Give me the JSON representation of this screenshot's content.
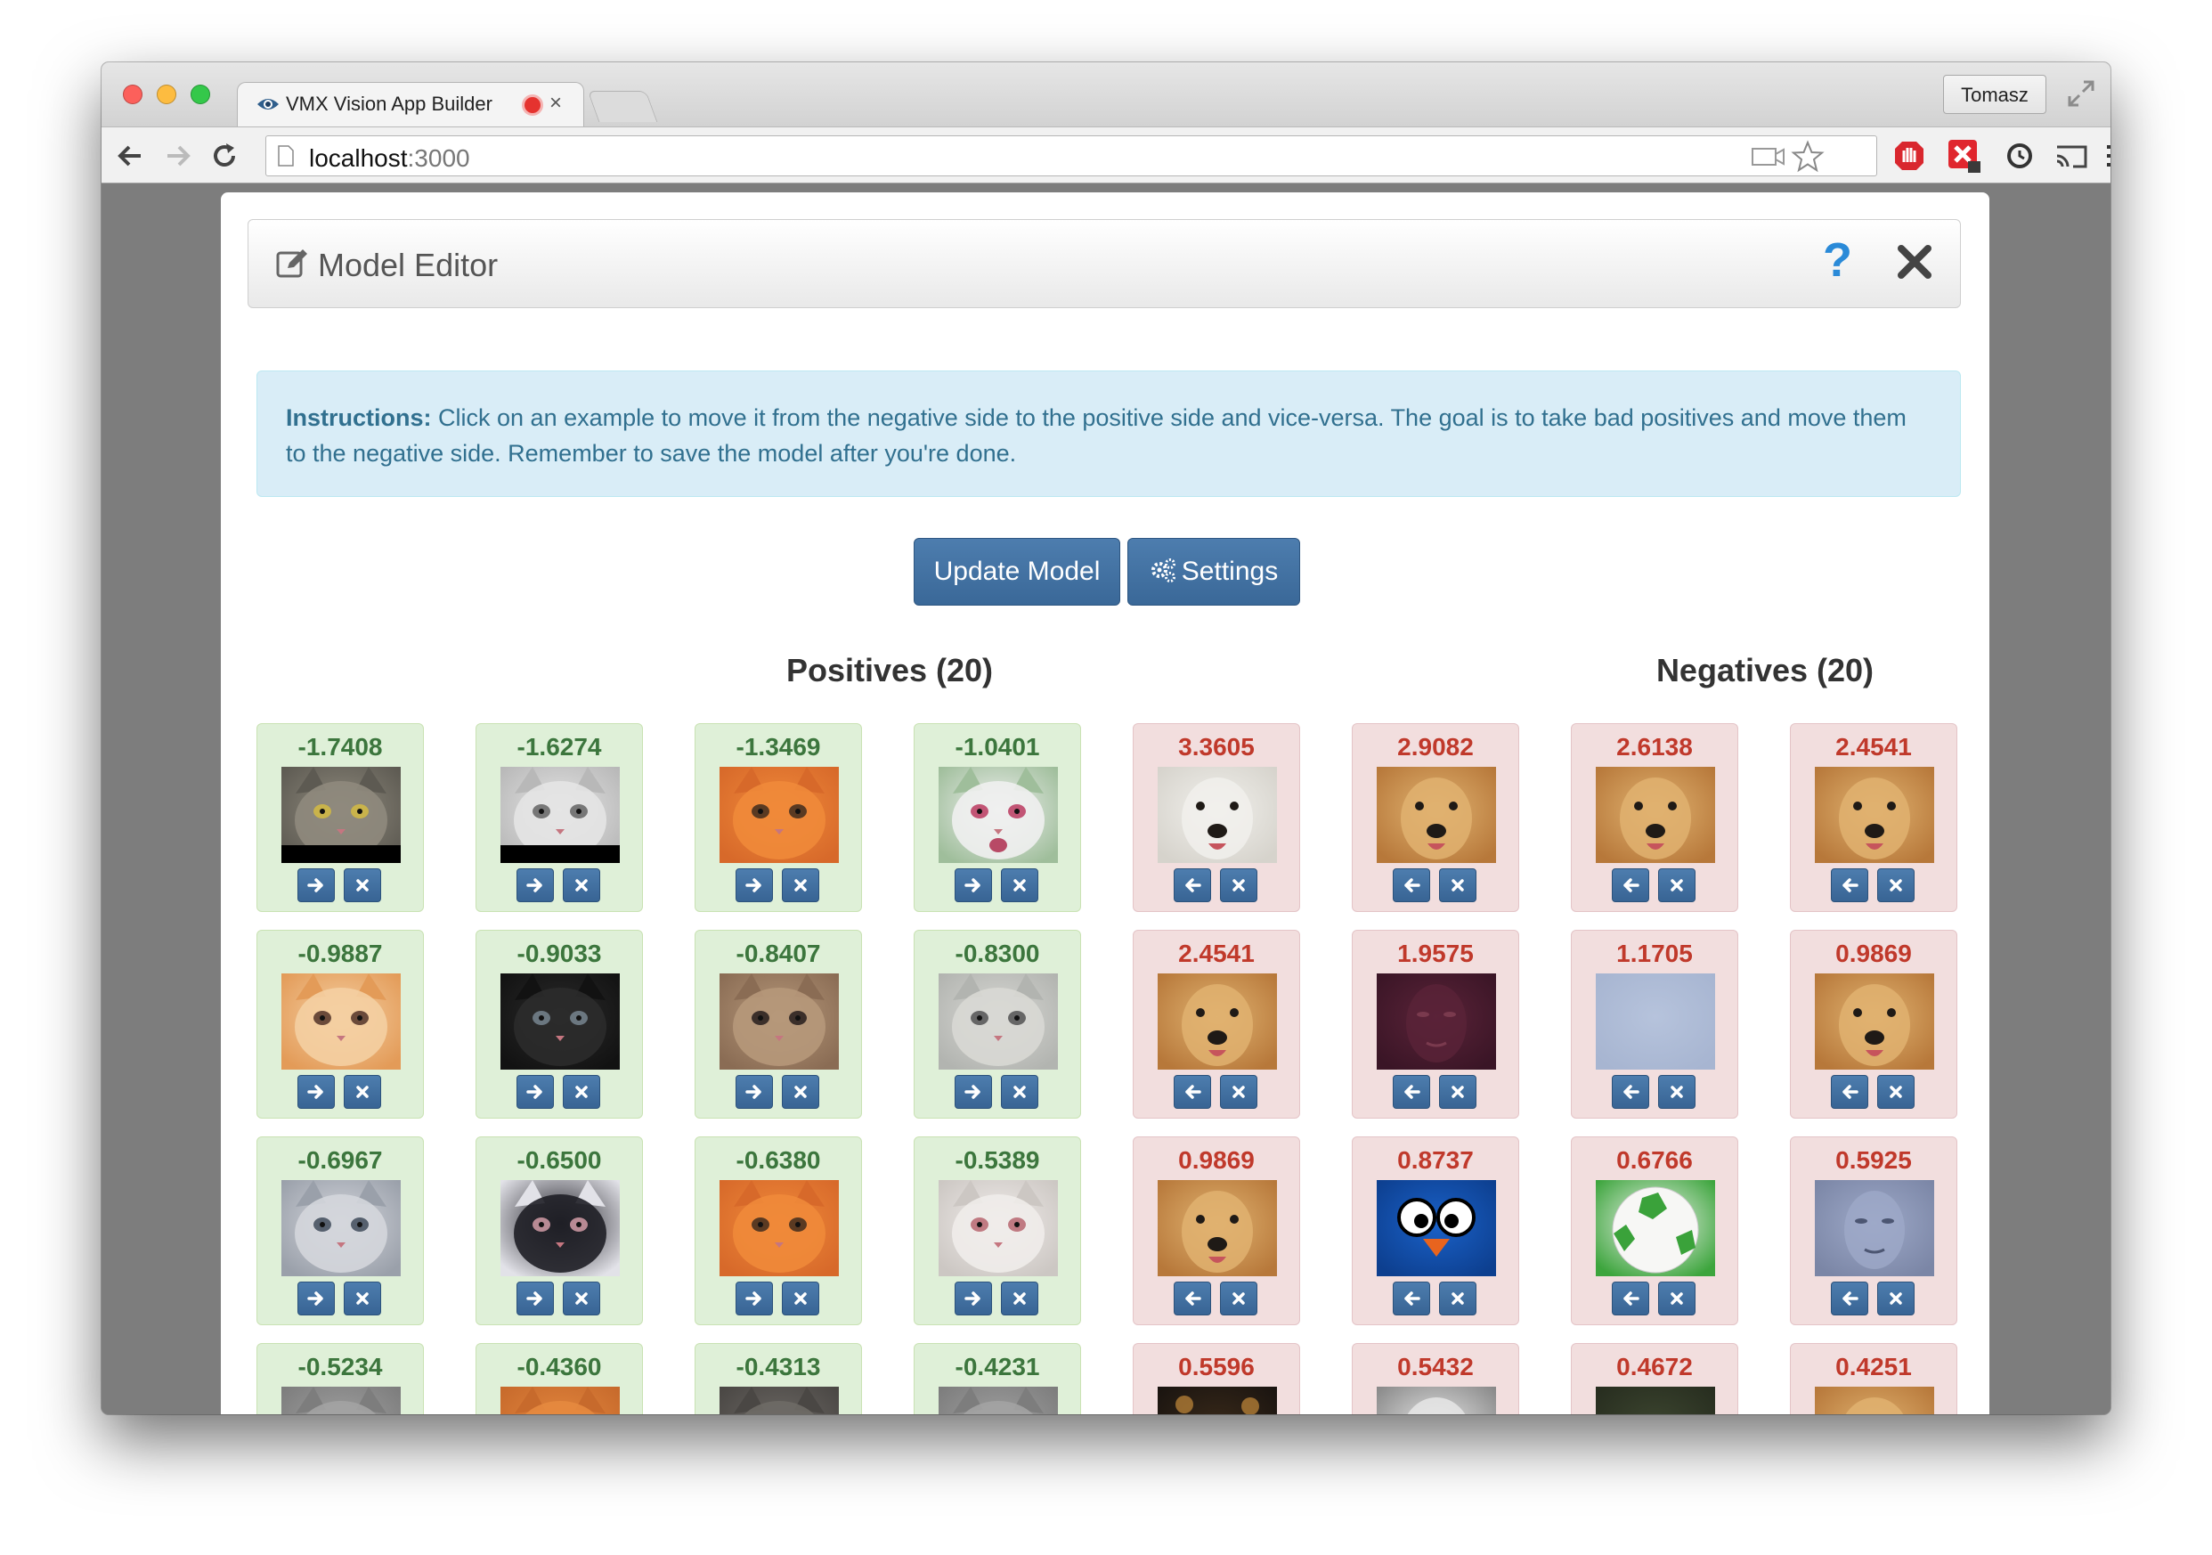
{
  "browser": {
    "tab_title": "VMX Vision App Builder",
    "tab_close": "×",
    "profile_name": "Tomasz",
    "url_host": "localhost",
    "url_port": ":3000"
  },
  "modal": {
    "title": "Model Editor",
    "help_label": "?",
    "instructions_label": "Instructions:",
    "instructions_text": " Click on an example to move it from the negative side to the positive side and vice-versa. The goal is to take bad positives and move them to the negative side. Remember to save the model after you're done.",
    "update_button": "Update Model",
    "settings_button": "Settings",
    "positives_heading": "Positives (20)",
    "negatives_heading": "Negatives (20)"
  },
  "positives": [
    {
      "score": "-1.7408",
      "image": "gray cat face"
    },
    {
      "score": "-1.6274",
      "image": "white kitten face"
    },
    {
      "score": "-1.3469",
      "image": "orange kitten face"
    },
    {
      "score": "-1.0401",
      "image": "white kitten open mouth"
    },
    {
      "score": "-0.9887",
      "image": "orange white cat face"
    },
    {
      "score": "-0.9033",
      "image": "black kitten face"
    },
    {
      "score": "-0.8407",
      "image": "tabby kitten face"
    },
    {
      "score": "-0.8300",
      "image": "white cat closeup"
    },
    {
      "score": "-0.6967",
      "image": "white gray cat face"
    },
    {
      "score": "-0.6500",
      "image": "black white cat face"
    },
    {
      "score": "-0.6380",
      "image": "orange kitten face"
    },
    {
      "score": "-0.5389",
      "image": "white cat squinting"
    },
    {
      "score": "-0.5234",
      "image": "gray cat"
    },
    {
      "score": "-0.4360",
      "image": "orange cat"
    },
    {
      "score": "-0.4313",
      "image": "dark cat"
    },
    {
      "score": "-0.4231",
      "image": "gray cat"
    }
  ],
  "negatives": [
    {
      "score": "3.3605",
      "image": "white dog face"
    },
    {
      "score": "2.9082",
      "image": "golden dog face"
    },
    {
      "score": "2.6138",
      "image": "golden dog face"
    },
    {
      "score": "2.4541",
      "image": "golden dog face"
    },
    {
      "score": "2.4541",
      "image": "golden dog face"
    },
    {
      "score": "1.9575",
      "image": "dark face"
    },
    {
      "score": "1.1705",
      "image": "blank blue patch"
    },
    {
      "score": "0.9869",
      "image": "golden dog face"
    },
    {
      "score": "0.9869",
      "image": "golden dog face"
    },
    {
      "score": "0.8737",
      "image": "blue cartoon bird"
    },
    {
      "score": "0.6766",
      "image": "soccer ball"
    },
    {
      "score": "0.5925",
      "image": "blue tinted face"
    },
    {
      "score": "0.5596",
      "image": "dark scene"
    },
    {
      "score": "0.5432",
      "image": "white dog"
    },
    {
      "score": "0.4672",
      "image": "dark green"
    },
    {
      "score": "0.4251",
      "image": "golden dog"
    }
  ]
}
